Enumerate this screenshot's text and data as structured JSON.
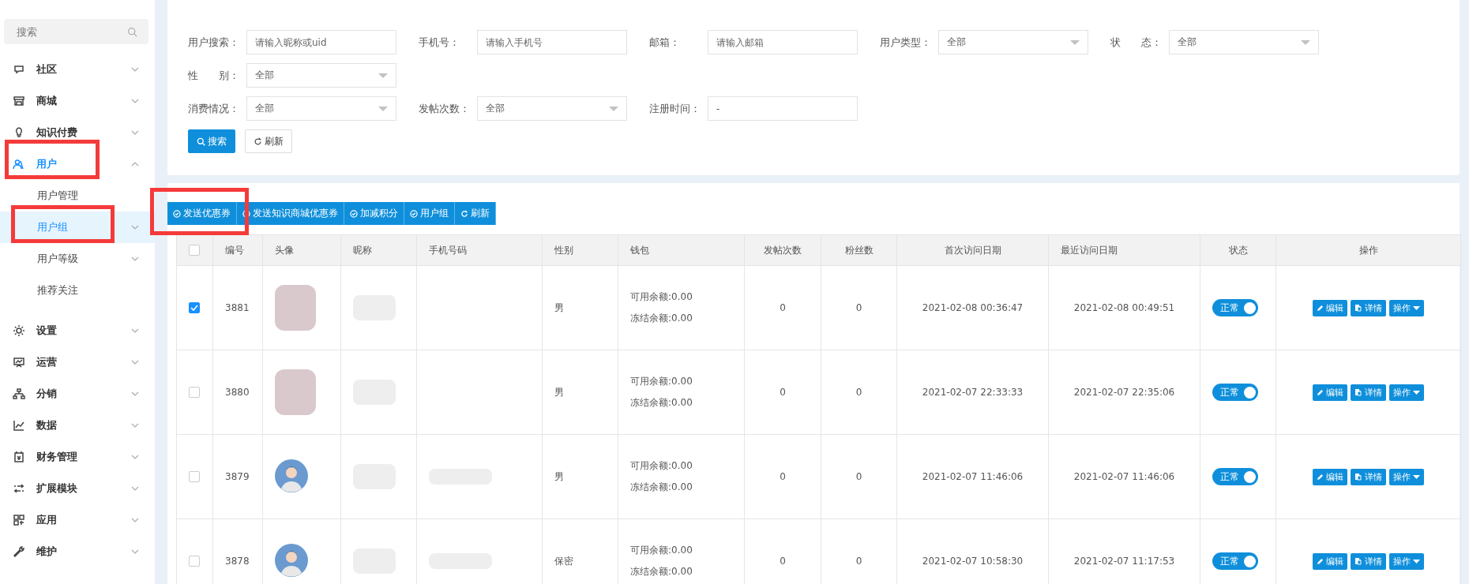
{
  "sidebar": {
    "search": {
      "placeholder": "搜索"
    },
    "items": [
      {
        "label": "社区",
        "expanded": false,
        "selected": false
      },
      {
        "label": "商城",
        "expanded": false,
        "selected": false
      },
      {
        "label": "知识付费",
        "expanded": false,
        "selected": false
      },
      {
        "label": "用户",
        "expanded": true,
        "selected": true,
        "children": [
          {
            "label": "用户管理",
            "selected": false,
            "has_caret": false
          },
          {
            "label": "用户组",
            "selected": true,
            "has_caret": true
          },
          {
            "label": "用户等级",
            "selected": false,
            "has_caret": true
          },
          {
            "label": "推荐关注",
            "selected": false,
            "has_caret": false
          }
        ]
      },
      {
        "label": "设置",
        "expanded": false,
        "selected": false
      },
      {
        "label": "运营",
        "expanded": false,
        "selected": false
      },
      {
        "label": "分销",
        "expanded": false,
        "selected": false
      },
      {
        "label": "数据",
        "expanded": false,
        "selected": false
      },
      {
        "label": "财务管理",
        "expanded": false,
        "selected": false
      },
      {
        "label": "扩展模块",
        "expanded": false,
        "selected": false
      },
      {
        "label": "应用",
        "expanded": false,
        "selected": false
      },
      {
        "label": "维护",
        "expanded": false,
        "selected": false
      }
    ]
  },
  "search_form": {
    "rows": [
      [
        {
          "label": "用户搜索：",
          "kind": "input",
          "placeholder": "请输入昵称或uid"
        },
        {
          "label": "手机号：",
          "kind": "input",
          "placeholder": "请输入手机号"
        },
        {
          "label": "邮箱：",
          "kind": "input",
          "placeholder": "请输入邮箱"
        },
        {
          "label": "用户类型：",
          "kind": "select",
          "value": "全部"
        },
        {
          "label": "状　　态：",
          "kind": "select",
          "value": "全部"
        }
      ],
      [
        {
          "label": "性　　别：",
          "kind": "select",
          "value": "全部"
        }
      ],
      [
        {
          "label": "消费情况：",
          "kind": "select",
          "value": "全部"
        },
        {
          "label": "发帖次数：",
          "kind": "select",
          "value": "全部"
        },
        {
          "label": "注册时间：",
          "kind": "input",
          "value": "-"
        }
      ]
    ],
    "buttons": [
      {
        "label": "搜索",
        "kind": "primary"
      },
      {
        "label": "刷新",
        "kind": "default"
      }
    ]
  },
  "toolbar": [
    "发送优惠券",
    "发送知识商城优惠券",
    "加减积分",
    "用户组",
    "刷新"
  ],
  "table": {
    "select_all": false,
    "columns": [
      "编号",
      "头像",
      "昵称",
      "手机号码",
      "性别",
      "钱包",
      "发帖次数",
      "粉丝数",
      "首次访问日期",
      "最近访问日期",
      "状态",
      "操作"
    ],
    "rows": [
      {
        "selected": true,
        "id": "3881",
        "avatar": {
          "kind": "photo"
        },
        "phone_hidden": false,
        "actions": [
          "编辑",
          "详情",
          "操作"
        ],
        "gender": "男",
        "available": "可用余额:0.00",
        "frozen": "冻结余额:0.00",
        "posts": "0",
        "fans": "0",
        "first_visit": "2021-02-08 00:36:47",
        "last_visit": "2021-02-08 00:49:51",
        "status": {
          "label": "正常",
          "on": true
        }
      },
      {
        "selected": false,
        "id": "3880",
        "avatar": {
          "kind": "photo"
        },
        "phone_hidden": false,
        "actions": [
          "编辑",
          "详情",
          "操作"
        ],
        "gender": "男",
        "available": "可用余额:0.00",
        "frozen": "冻结余额:0.00",
        "posts": "0",
        "fans": "0",
        "first_visit": "2021-02-07 22:33:33",
        "last_visit": "2021-02-07 22:35:06",
        "status": {
          "label": "正常",
          "on": true
        }
      },
      {
        "selected": false,
        "id": "3879",
        "avatar": {
          "kind": "default"
        },
        "phone_hidden": true,
        "actions": [
          "编辑",
          "详情",
          "操作"
        ],
        "gender": "男",
        "available": "可用余额:0.00",
        "frozen": "冻结余额:0.00",
        "posts": "0",
        "fans": "0",
        "first_visit": "2021-02-07 11:46:06",
        "last_visit": "2021-02-07 11:46:06",
        "status": {
          "label": "正常",
          "on": true
        }
      },
      {
        "selected": false,
        "id": "3878",
        "avatar": {
          "kind": "default"
        },
        "phone_hidden": true,
        "actions": [
          "编辑",
          "详情",
          "操作"
        ],
        "gender": "保密",
        "available": "可用余额:0.00",
        "frozen": "冻结余额:0.00",
        "posts": "0",
        "fans": "0",
        "first_visit": "2021-02-07 10:58:30",
        "last_visit": "2021-02-07 11:17:53",
        "status": {
          "label": "正常",
          "on": true
        }
      }
    ]
  }
}
